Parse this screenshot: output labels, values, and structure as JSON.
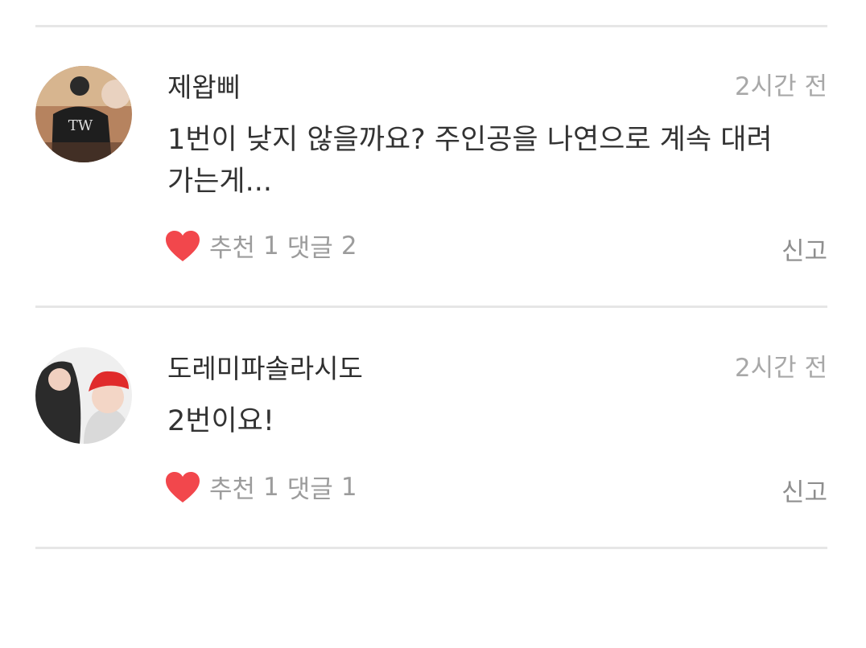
{
  "colors": {
    "heart": "#f2474c",
    "divider": "#e6e6e6",
    "meta_text": "#a8a8a8"
  },
  "comments": [
    {
      "author": "제왑삐",
      "time": "2시간 전",
      "text": "1번이 낮지 않을까요? 주인공을 나연으로 계속 대려가는게...",
      "like_label": "추천",
      "like_count": "1",
      "reply_label": "댓글",
      "reply_count": "2",
      "report_label": "신고",
      "avatar_icon": "user-avatar-photo"
    },
    {
      "author": "도레미파솔라시도",
      "time": "2시간 전",
      "text": "2번이요!",
      "like_label": "추천",
      "like_count": "1",
      "reply_label": "댓글",
      "reply_count": "1",
      "report_label": "신고",
      "avatar_icon": "user-avatar-photo"
    }
  ]
}
